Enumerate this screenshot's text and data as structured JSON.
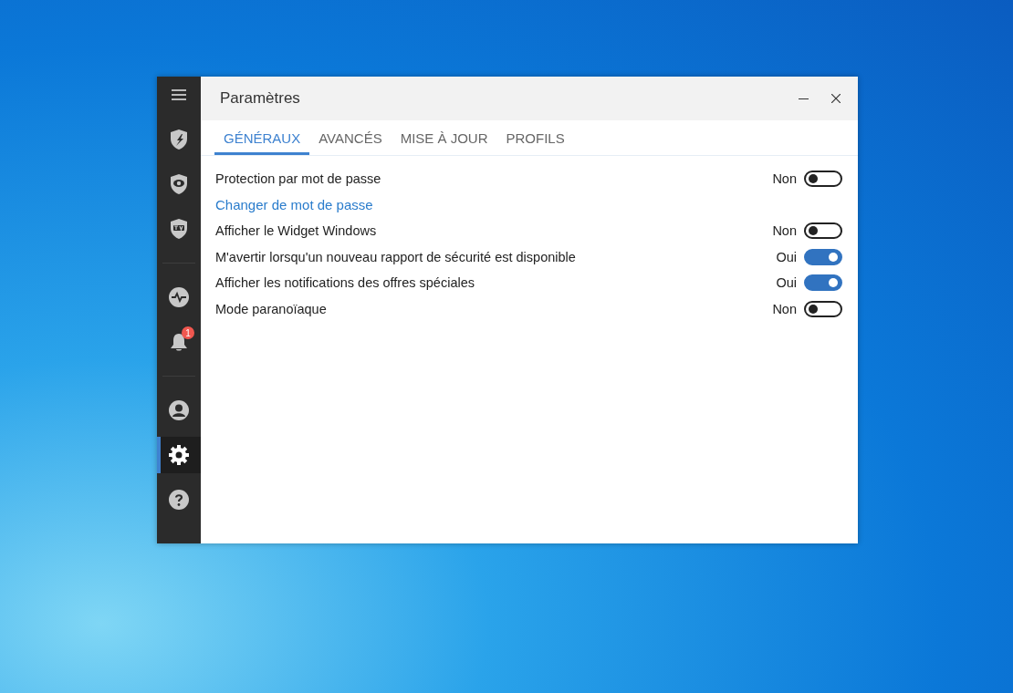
{
  "window": {
    "title": "Paramètres"
  },
  "sidebar": {
    "groups": [
      [
        {
          "kind": "shield-bolt",
          "selected": false
        },
        {
          "kind": "shield-eye",
          "selected": false
        },
        {
          "kind": "shield-tools",
          "selected": false
        }
      ],
      [
        {
          "kind": "pulse",
          "selected": false
        },
        {
          "kind": "bell",
          "selected": false,
          "badge": "1"
        }
      ],
      [
        {
          "kind": "user",
          "selected": false
        },
        {
          "kind": "gear",
          "selected": true
        },
        {
          "kind": "help",
          "selected": false
        }
      ]
    ]
  },
  "tabs": [
    {
      "label": "GÉNÉRAUX",
      "selected": true
    },
    {
      "label": "AVANCÉS",
      "selected": false
    },
    {
      "label": "MISE À JOUR",
      "selected": false
    },
    {
      "label": "PROFILS",
      "selected": false
    }
  ],
  "settings": [
    {
      "kind": "toggle",
      "label": "Protection par mot de passe",
      "state": "Non",
      "on": false
    },
    {
      "kind": "link",
      "label": "Changer de mot de passe"
    },
    {
      "kind": "toggle",
      "label": "Afficher le Widget Windows",
      "state": "Non",
      "on": false
    },
    {
      "kind": "toggle",
      "label": "M'avertir lorsqu'un nouveau rapport de sécurité est disponible",
      "state": "Oui",
      "on": true
    },
    {
      "kind": "toggle",
      "label": "Afficher les notifications des offres spéciales",
      "state": "Oui",
      "on": true
    },
    {
      "kind": "toggle",
      "label": "Mode paranoïaque",
      "state": "Non",
      "on": false
    }
  ]
}
